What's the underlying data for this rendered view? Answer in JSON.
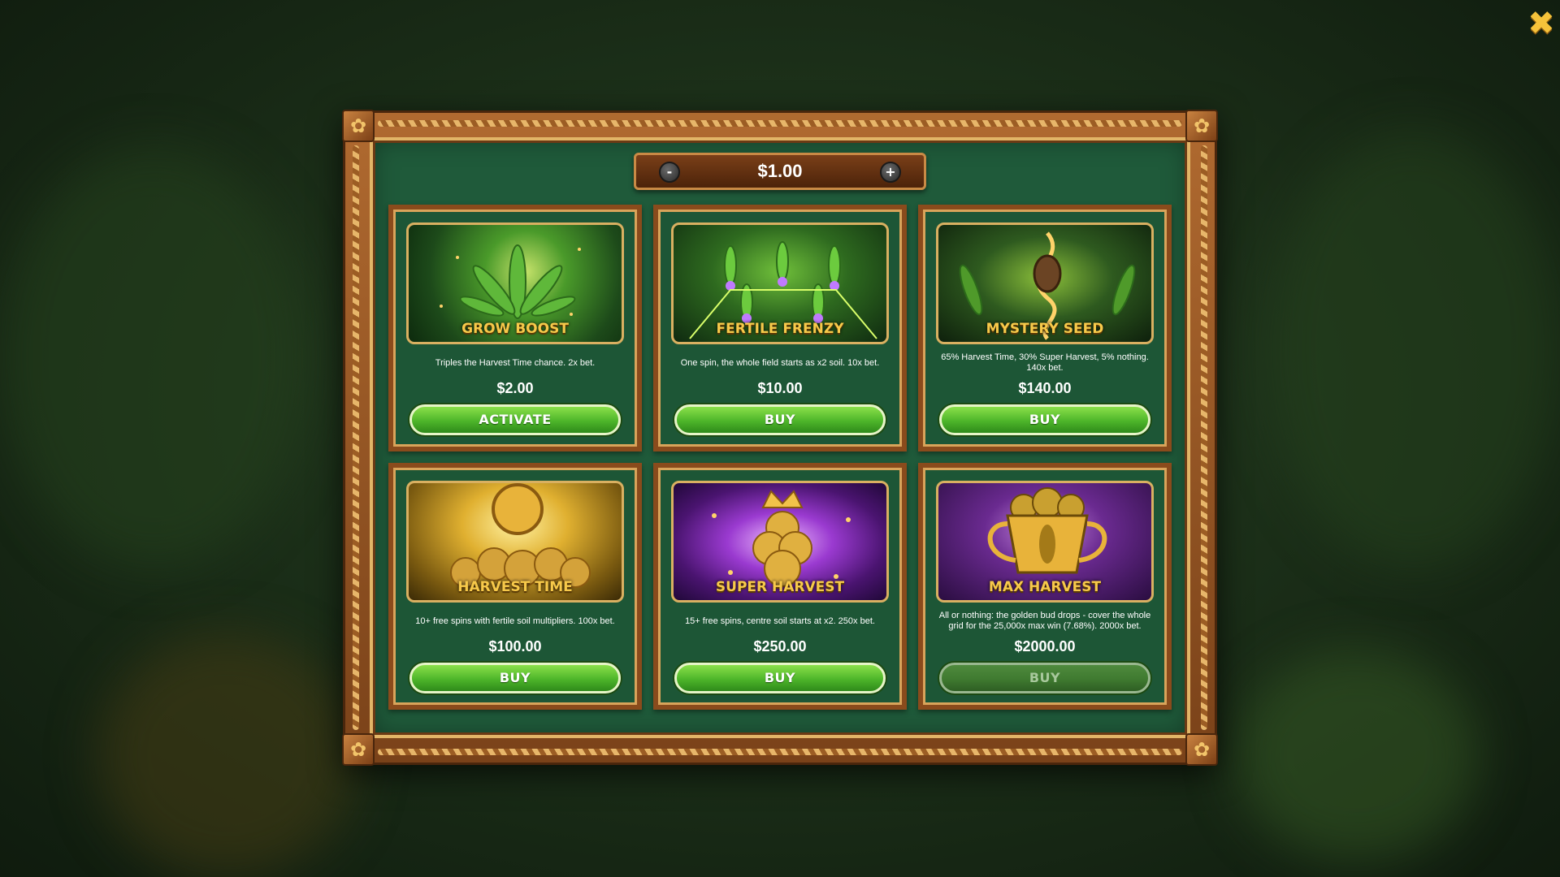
{
  "close_label": "✖",
  "bet": {
    "value": "$1.00",
    "minus_label": "-",
    "plus_label": "+"
  },
  "cards": [
    {
      "title": "GROW BOOST",
      "desc": "Triples the Harvest Time chance. 2x bet.",
      "price": "$2.00",
      "button": "ACTIVATE",
      "enabled": true,
      "art": "green-leaves"
    },
    {
      "title": "FERTILE FRENZY",
      "desc": "One spin, the whole field starts as x2 soil. 10x bet.",
      "price": "$10.00",
      "button": "BUY",
      "enabled": true,
      "art": "green-purple-field"
    },
    {
      "title": "MYSTERY SEED",
      "desc": "65% Harvest Time, 30% Super Harvest, 5% nothing. 140x bet.",
      "price": "$140.00",
      "button": "BUY",
      "enabled": true,
      "art": "golden-seed"
    },
    {
      "title": "HARVEST TIME",
      "desc": "10+ free spins with fertile soil multipliers. 100x bet.",
      "price": "$100.00",
      "button": "BUY",
      "enabled": true,
      "art": "golden-coin"
    },
    {
      "title": "SUPER HARVEST",
      "desc": "15+ free spins, centre soil starts at x2. 250x bet.",
      "price": "$250.00",
      "button": "BUY",
      "enabled": true,
      "art": "purple-crown"
    },
    {
      "title": "MAX HARVEST",
      "desc": "All or nothing: the golden bud drops - cover the whole grid for the 25,000x max win (7.68%). 2000x bet.",
      "price": "$2000.00",
      "button": "BUY",
      "enabled": false,
      "art": "golden-trophy"
    }
  ],
  "colors": {
    "accent_gold": "#f7c94a",
    "button_green": "#4db52a",
    "felt": "#1f5a3a",
    "wood": "#8a4b1c"
  }
}
